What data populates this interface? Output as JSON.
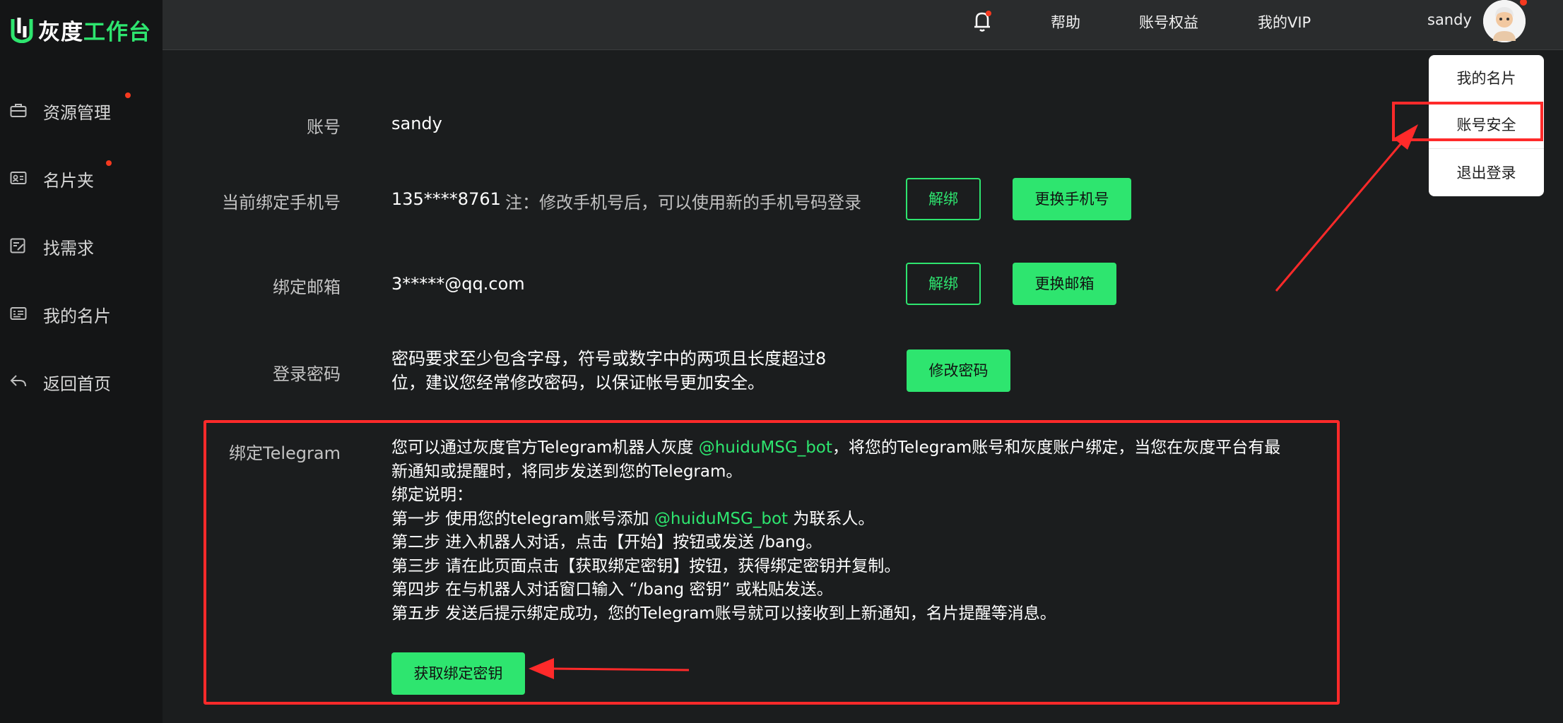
{
  "brand": {
    "name_part1": "灰度",
    "name_part2": "工作台"
  },
  "sidebar": {
    "items": [
      {
        "label": "资源管理",
        "icon": "briefcase-icon",
        "has_dot": true
      },
      {
        "label": "名片夹",
        "icon": "card-holder-icon",
        "has_dot": true
      },
      {
        "label": "找需求",
        "icon": "edit-note-icon",
        "has_dot": false
      },
      {
        "label": "我的名片",
        "icon": "id-card-icon",
        "has_dot": false
      },
      {
        "label": "返回首页",
        "icon": "back-arrow-icon",
        "has_dot": false
      }
    ]
  },
  "header": {
    "help": "帮助",
    "account_rights": "账号权益",
    "my_vip": "我的VIP",
    "username": "sandy"
  },
  "dropdown": {
    "my_card": "我的名片",
    "account_security": "账号安全",
    "logout": "退出登录"
  },
  "account": {
    "label": "账号",
    "value": "sandy"
  },
  "phone": {
    "label": "当前绑定手机号",
    "value": "135****8761",
    "note": "注：修改手机号后，可以使用新的手机号码登录",
    "unbind": "解绑",
    "change": "更换手机号"
  },
  "email": {
    "label": "绑定邮箱",
    "value": "3*****@qq.com",
    "unbind": "解绑",
    "change": "更换邮箱"
  },
  "password": {
    "label": "登录密码",
    "line1": "密码要求至少包含字母，符号或数字中的两项且长度超过8",
    "line2": "位，建议您经常修改密码，以保证帐号更加安全。",
    "change": "修改密码"
  },
  "telegram": {
    "label": "绑定Telegram",
    "intro_a": "您可以通过灰度官方Telegram机器人灰度 ",
    "bot": "@huiduMSG_bot",
    "intro_b": "，将您的Telegram账号和灰度账户绑定，当您在灰度平台有最",
    "intro_c": "新通知或提醒时，将同步发送到您的Telegram。",
    "explain": "绑定说明：",
    "step1_a": "第一步 使用您的telegram账号添加 ",
    "step1_b": " 为联系人。",
    "step2": "第二步 进入机器人对话，点击【开始】按钮或发送 /bang。",
    "step3": "第三步 请在此页面点击【获取绑定密钥】按钮，获得绑定密钥并复制。",
    "step4": "第四步 在与机器人对话窗口输入 “/bang 密钥” 或粘贴发送。",
    "step5": "第五步 发送后提示绑定成功，您的Telegram账号就可以接收到上新通知，名片提醒等消息。",
    "get_key": "获取绑定密钥"
  },
  "colors": {
    "accent": "#2ee56f",
    "annotation": "#ff2a2a",
    "notification_dot": "#f5391f"
  }
}
